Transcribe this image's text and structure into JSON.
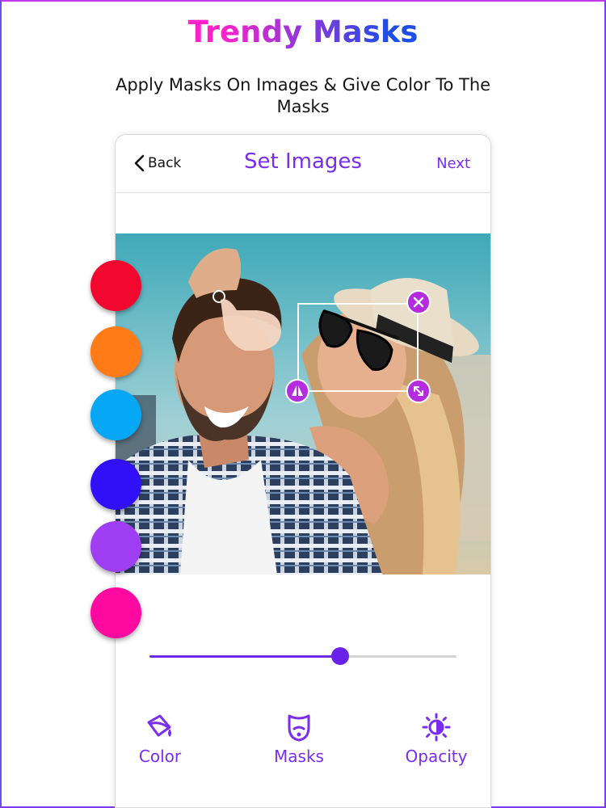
{
  "header": {
    "title": "Trendy Masks",
    "subtitle": "Apply Masks On Images & Give Color To The Masks"
  },
  "nav": {
    "back_label": "Back",
    "title": "Set Images",
    "next_label": "Next"
  },
  "palette": [
    {
      "name": "red",
      "color": "#f2082f"
    },
    {
      "name": "orange",
      "color": "#ff7b17"
    },
    {
      "name": "sky-blue",
      "color": "#06a7f4"
    },
    {
      "name": "blue-violet",
      "color": "#3210f7"
    },
    {
      "name": "purple",
      "color": "#9f3ef2"
    },
    {
      "name": "magenta",
      "color": "#ff0aa0"
    }
  ],
  "slider": {
    "value": 0.62
  },
  "toolbar": {
    "color_label": "Color",
    "masks_label": "Masks",
    "opacity_label": "Opacity"
  },
  "icons": {
    "back": "chevron-left-icon",
    "close": "close-icon",
    "flip": "flip-icon",
    "resize": "resize-icon",
    "color": "paint-bucket-icon",
    "masks": "beard-mask-icon",
    "opacity": "brightness-icon"
  },
  "colors": {
    "accent": "#7a2df0",
    "handle": "#b52be0"
  }
}
